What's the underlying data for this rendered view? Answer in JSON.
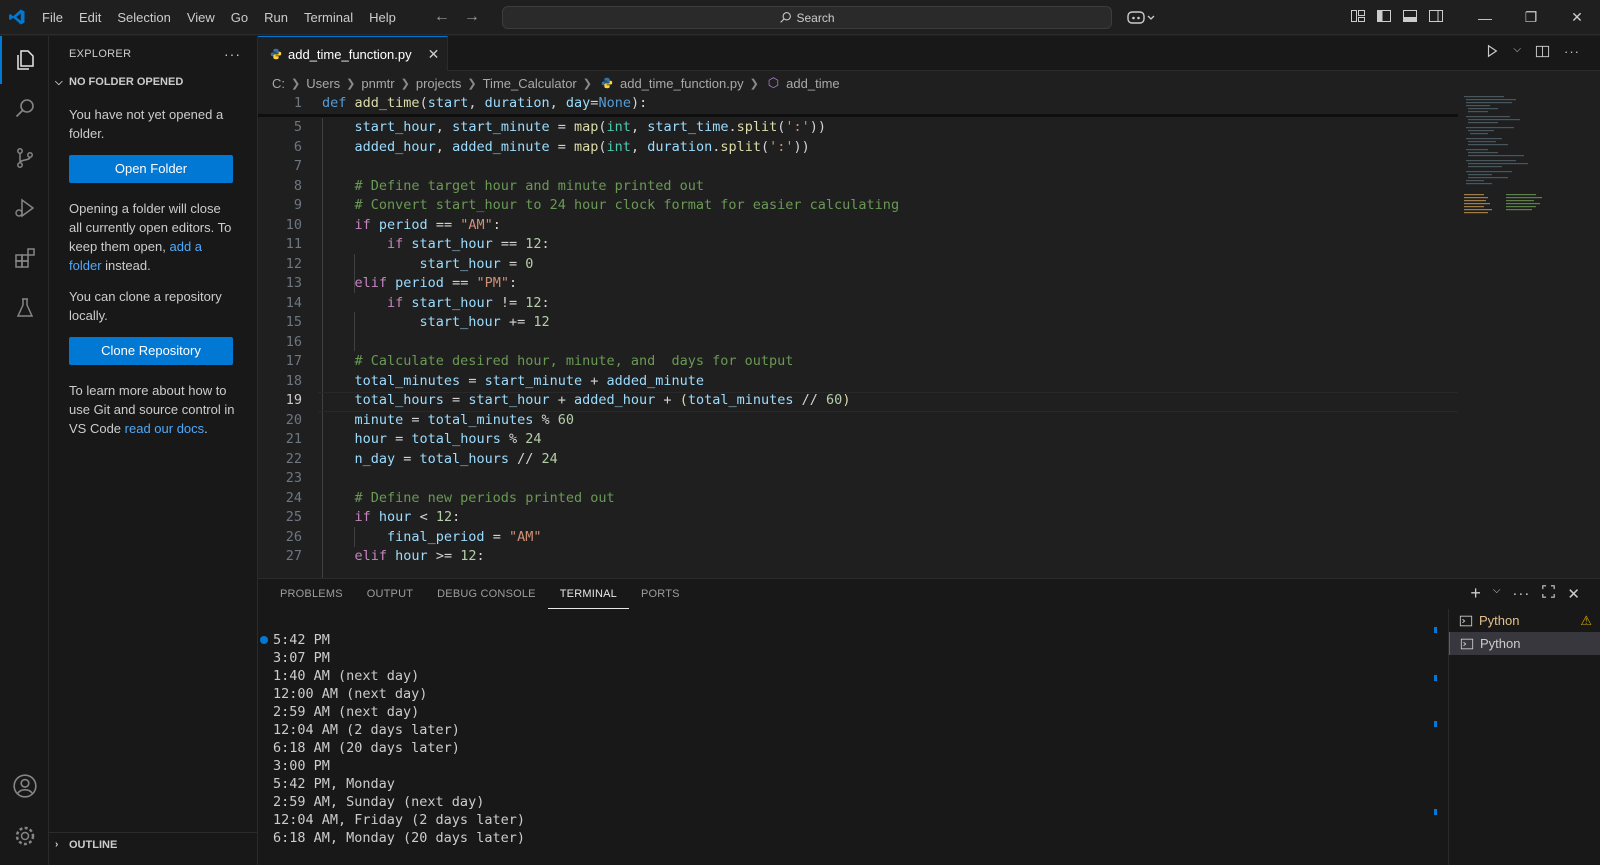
{
  "menu": [
    "File",
    "Edit",
    "Selection",
    "View",
    "Go",
    "Run",
    "Terminal",
    "Help"
  ],
  "search": {
    "label": "Search"
  },
  "sidebar": {
    "title": "EXPLORER",
    "more": "···",
    "section": "NO FOLDER OPENED",
    "msg1": "You have not yet opened a folder.",
    "open_button": "Open Folder",
    "msg2_a": "Opening a folder will close all currently open editors. To keep them open,",
    "msg2_link": "add a folder",
    "msg2_b": "instead.",
    "msg3": "You can clone a repository locally.",
    "clone_button": "Clone Repository",
    "msg4_a": "To learn more about how to use Git and source control in VS Code",
    "msg4_link": "read our docs",
    "msg4_b": ".",
    "outline": "OUTLINE"
  },
  "tab": {
    "label": "add_time_function.py",
    "close": "✕"
  },
  "breadcrumb": [
    "C:",
    "Users",
    "pnmtr",
    "projects",
    "Time_Calculator",
    "add_time_function.py",
    "add_time"
  ],
  "editor": {
    "current_line": 19,
    "line_numbers": [
      "1",
      "5",
      "6",
      "7",
      "8",
      "9",
      "10",
      "11",
      "12",
      "13",
      "14",
      "15",
      "16",
      "17",
      "18",
      "19",
      "20",
      "21",
      "22",
      "23",
      "24",
      "25",
      "26",
      "27"
    ]
  },
  "panel": {
    "tabs": [
      "PROBLEMS",
      "OUTPUT",
      "DEBUG CONSOLE",
      "TERMINAL",
      "PORTS"
    ],
    "active_tab": "TERMINAL",
    "terminal_lines": [
      "5:42 PM",
      "3:07 PM",
      "1:40 AM (next day)",
      "12:00 AM (next day)",
      "2:59 AM (next day)",
      "12:04 AM (2 days later)",
      "6:18 AM (20 days later)",
      "3:00 PM",
      "5:42 PM, Monday",
      "2:59 AM, Sunday (next day)",
      "12:04 AM, Friday (2 days later)",
      "6:18 AM, Monday (20 days later)"
    ],
    "terminals": [
      {
        "label": "Python",
        "warning": true
      },
      {
        "label": "Python",
        "warning": false
      }
    ]
  },
  "colors": {
    "accent": "#0078d4",
    "background": "#1f1f1f",
    "sidebar": "#181818"
  }
}
